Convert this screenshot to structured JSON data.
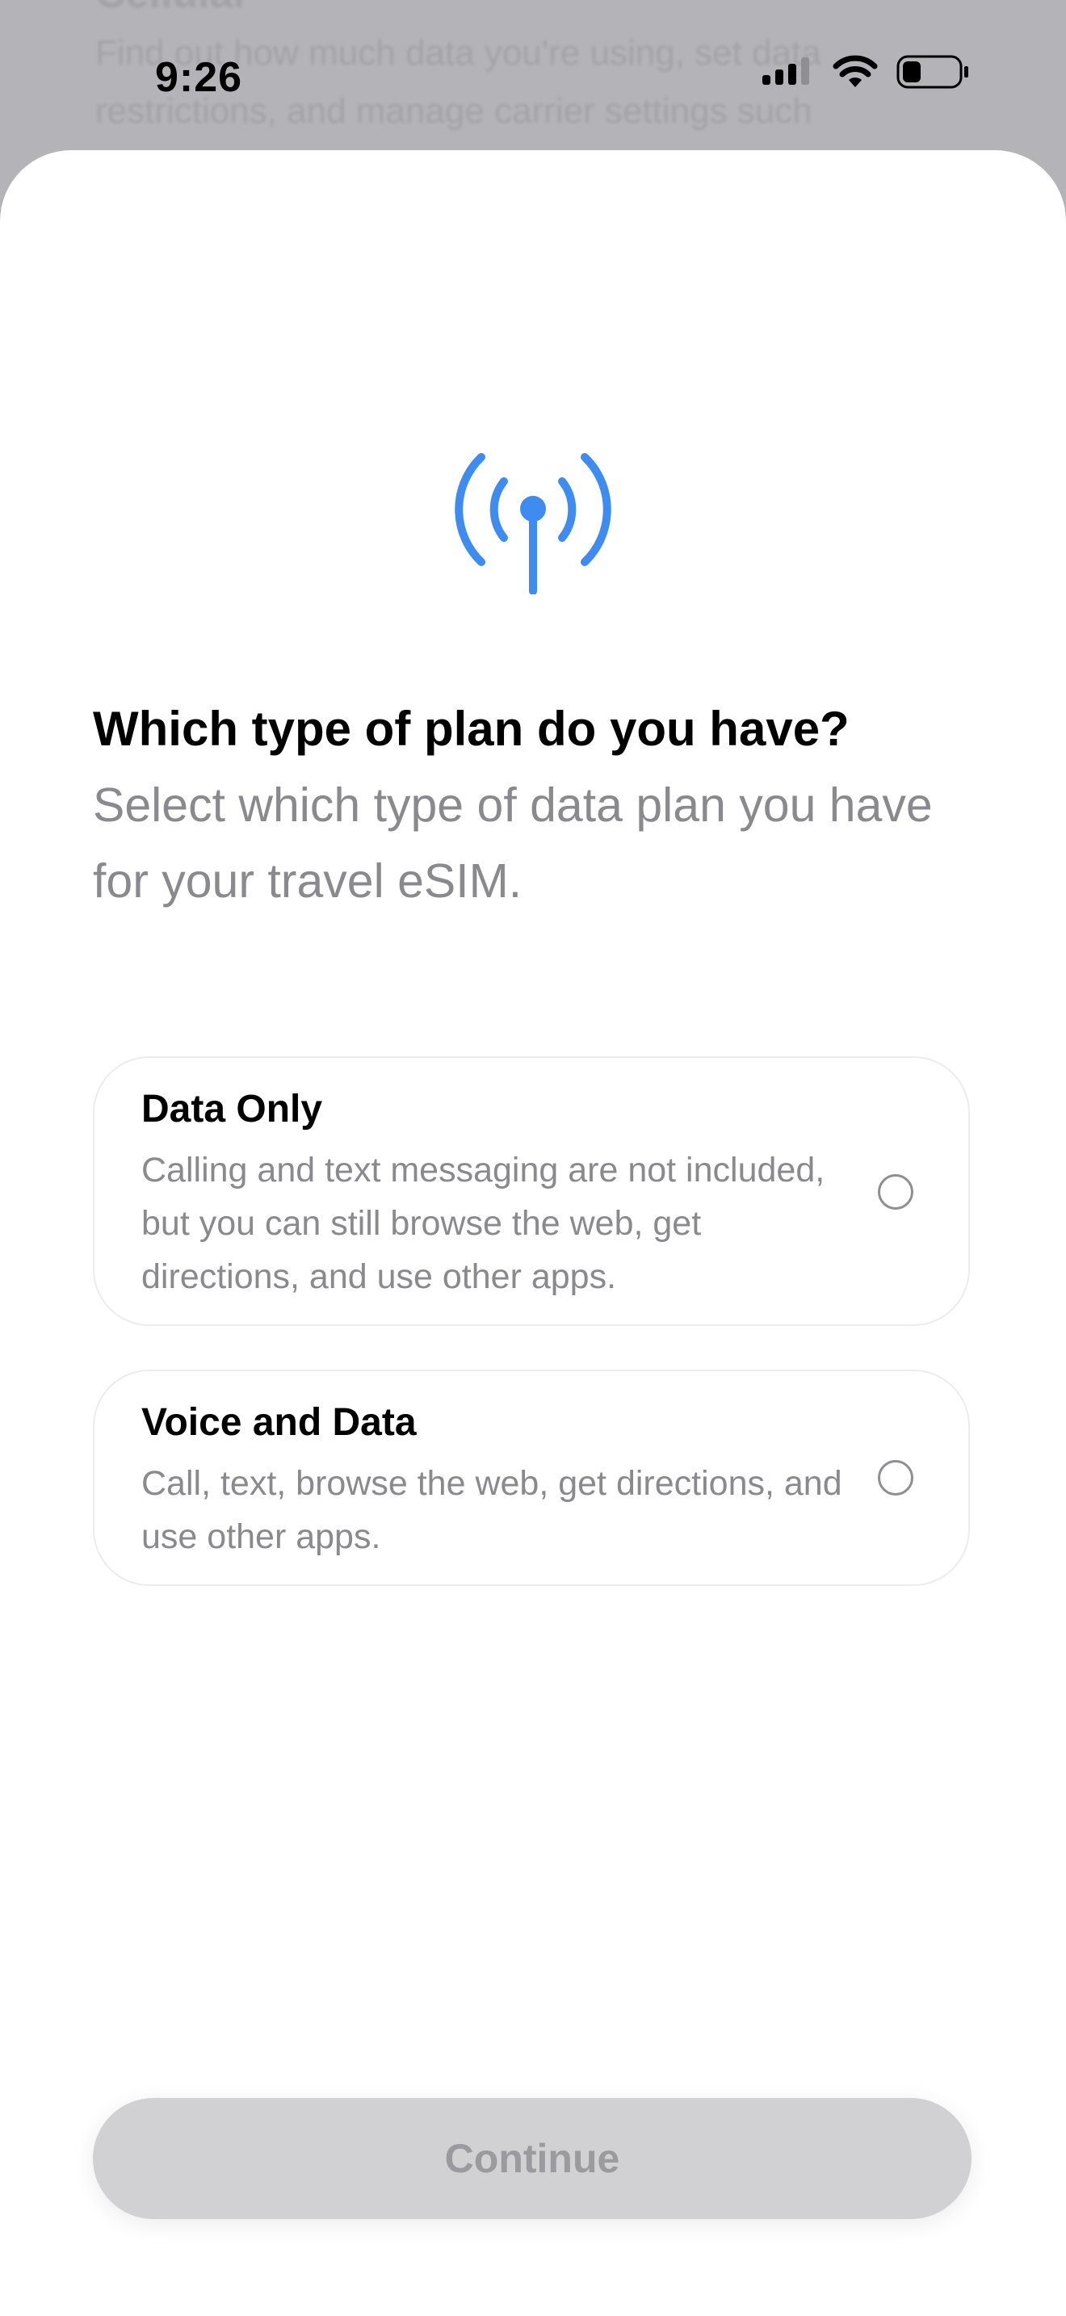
{
  "status_bar": {
    "time": "9:26"
  },
  "background_page": {
    "heading": "Cellular",
    "text": "Find out how much data you're using, set data restrictions, and manage carrier settings such"
  },
  "sheet": {
    "icon": "antenna-broadcast-icon",
    "title": "Which type of plan do you have?",
    "subtitle": "Select which type of data plan you have for your travel eSIM.",
    "options": [
      {
        "title": "Data Only",
        "description": "Calling and text messaging are not included, but you can still browse the web, get directions, and use other apps.",
        "selected": false
      },
      {
        "title": "Voice and Data",
        "description": "Call, text, browse the web, get directions, and use other apps.",
        "selected": false
      }
    ],
    "continue_label": "Continue",
    "continue_enabled": false
  },
  "colors": {
    "accent": "#3E8CF0",
    "secondary_text": "#8A8A8E",
    "disabled_button": "#D1D1D3"
  }
}
